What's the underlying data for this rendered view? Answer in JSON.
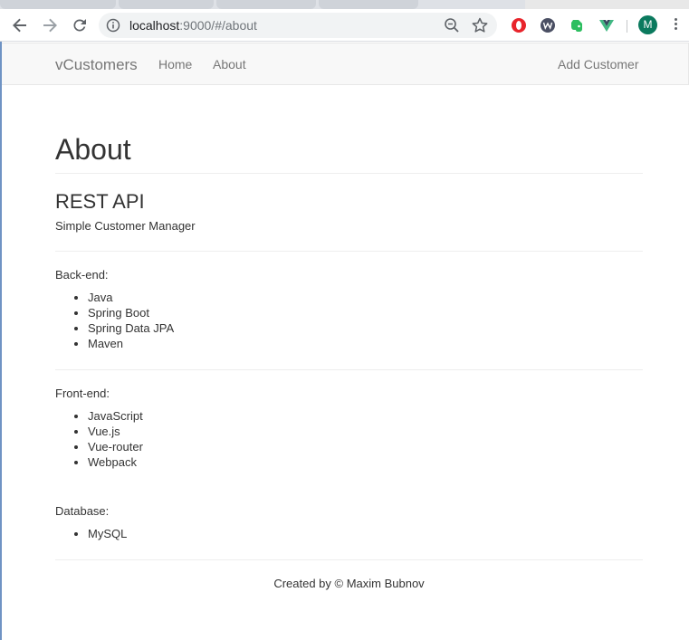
{
  "browser": {
    "url_host": "localhost",
    "url_rest": ":9000/#/about",
    "avatar_letter": "M",
    "extensions": [
      "opera-ad-block-icon",
      "wappalyzer-icon",
      "evernote-icon",
      "vue-devtools-icon"
    ]
  },
  "navbar": {
    "brand": "vCustomers",
    "links": [
      {
        "label": "Home"
      },
      {
        "label": "About"
      }
    ],
    "add_customer": "Add Customer"
  },
  "page": {
    "title": "About",
    "subtitle": "REST API",
    "lead": "Simple Customer Manager",
    "sections": [
      {
        "label": "Back-end:",
        "items": [
          "Java",
          "Spring Boot",
          "Spring Data JPA",
          "Maven"
        ]
      },
      {
        "label": "Front-end:",
        "items": [
          "JavaScript",
          "Vue.js",
          "Vue-router",
          "Webpack"
        ]
      },
      {
        "label": "Database:",
        "items": [
          "MySQL"
        ]
      }
    ],
    "footer": "Created by © Maxim Bubnov"
  }
}
